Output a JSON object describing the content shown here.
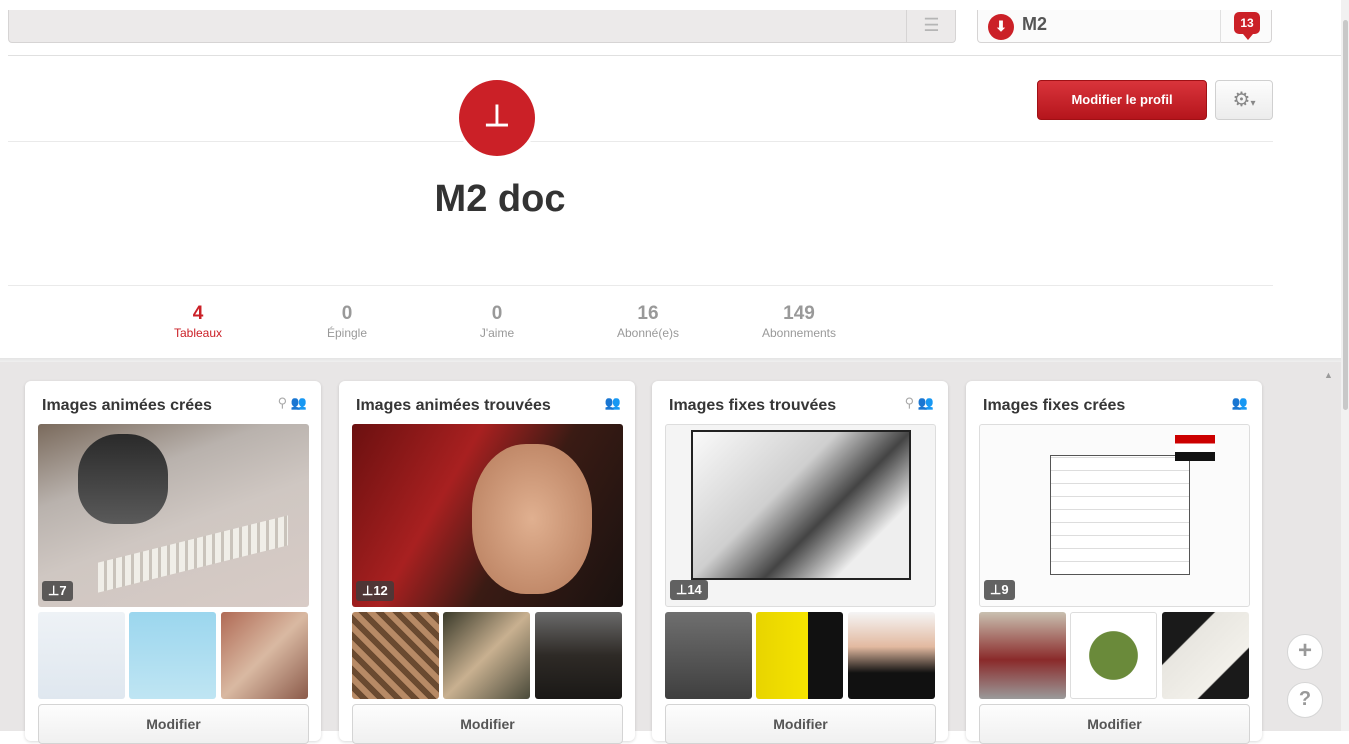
{
  "header": {
    "menu_icon": "hamburger-icon",
    "user_name": "M2",
    "notification_count": "13"
  },
  "profile": {
    "name": "M2 doc",
    "edit_label": "Modifier le profil",
    "settings_icon": "gear-icon"
  },
  "stats": [
    {
      "num": "4",
      "label": "Tableaux"
    },
    {
      "num": "0",
      "label": "Épingle"
    },
    {
      "num": "0",
      "label": "J'aime"
    },
    {
      "num": "16",
      "label": "Abonné(e)s"
    },
    {
      "num": "149",
      "label": "Abonnements"
    }
  ],
  "boards": [
    {
      "title": "Images animées crées",
      "pin_count": "7",
      "button": "Modifier",
      "has_map_icon": true
    },
    {
      "title": "Images animées trouvées",
      "pin_count": "12",
      "button": "Modifier",
      "has_map_icon": true
    },
    {
      "title": "Images fixes trouvées",
      "pin_count": "14",
      "button": "Modifier",
      "has_map_icon": true
    },
    {
      "title": "Images fixes crées",
      "pin_count": "9",
      "button": "Modifier",
      "has_map_icon": false
    }
  ],
  "side": {
    "add_icon": "plus-icon",
    "help_icon": "question-icon"
  },
  "colors": {
    "accent": "#cb2027"
  }
}
